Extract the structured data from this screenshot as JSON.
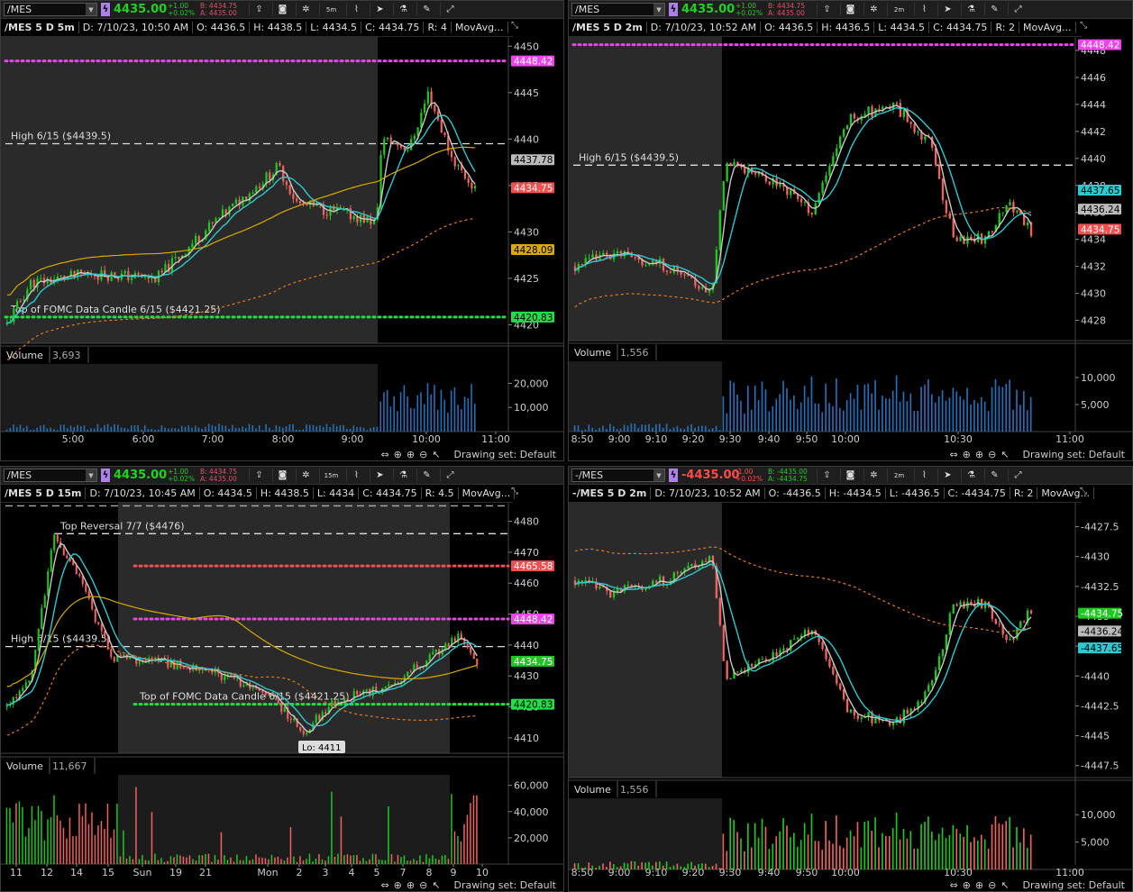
{
  "colors": {
    "up": "#1ec81e",
    "down": "#f0625f",
    "ma200": "#d8a900",
    "ema_cyan": "#2ec8d0",
    "ma_gray": "#c8c8c8",
    "vwap": "#e07a20",
    "magenta": "#ee44ee",
    "green_lvl": "#22dd44",
    "red_lvl": "#f05050",
    "vol_blue": "#2570b8"
  },
  "panels": [
    {
      "symbol": "/MES",
      "last": "4435.00",
      "neg": false,
      "change": "+1.00",
      "change_pct": "+0.02%",
      "bid": "B: 4434.75",
      "ask": "A: 4435.00",
      "timeframe": "5m",
      "info": [
        "/MES 5 D 5m",
        "D: 7/10/23, 10:50 AM",
        "O: 4436.5",
        "H: 4438.5",
        "L: 4434.5",
        "C: 4434.75",
        "R: 4",
        "MovAvg..."
      ],
      "volume_label": "Volume",
      "volume_value": "3,693",
      "price_ticks": [
        "4450",
        "4445",
        "4440",
        "4435",
        "4430",
        "4425",
        "4420"
      ],
      "vol_ticks": [
        "20,000",
        "10,000"
      ],
      "time_ticks": [
        "5:00",
        "6:00",
        "7:00",
        "8:00",
        "9:00",
        "10:00",
        "11:00"
      ],
      "annotations": [
        "High 6/15 ($4439.5)",
        "Top of FOMC Data Candle 6/15 ($4421.25)"
      ],
      "tags": [
        "4448.42",
        "4437.78",
        "4434.75",
        "4428.09",
        "4420.83"
      ],
      "drawing_set": "Drawing set: Default"
    },
    {
      "symbol": "/MES",
      "last": "4435.00",
      "neg": false,
      "change": "+1.00",
      "change_pct": "+0.02%",
      "bid": "B: 4434.75",
      "ask": "A: 4435.00",
      "timeframe": "2m",
      "info": [
        "/MES 5 D 2m",
        "D: 7/10/23, 10:52 AM",
        "O: 4436.5",
        "H: 4436.5",
        "L: 4434.5",
        "C: 4434.75",
        "R: 2",
        "MovAvg..."
      ],
      "volume_label": "Volume",
      "volume_value": "1,556",
      "price_ticks": [
        "4448",
        "4446",
        "4444",
        "4442",
        "4440",
        "4438",
        "4436",
        "4434",
        "4432",
        "4430",
        "4428"
      ],
      "vol_ticks": [
        "10,000",
        "5,000"
      ],
      "time_ticks": [
        "8:50",
        "9:00",
        "9:10",
        "9:20",
        "9:30",
        "9:40",
        "9:50",
        "10:00",
        "10:30",
        "11:00"
      ],
      "annotations": [
        "High 6/15 ($4439.5)"
      ],
      "tags": [
        "4448.42",
        "4437.65",
        "4436.24",
        "4434.75"
      ],
      "drawing_set": "Drawing set: Default"
    },
    {
      "symbol": "/MES",
      "last": "4435.00",
      "neg": false,
      "change": "+1.00",
      "change_pct": "+0.02%",
      "bid": "B: 4434.75",
      "ask": "A: 4435.00",
      "timeframe": "15m",
      "info": [
        "/MES 5 D 15m",
        "D: 7/10/23, 10:45 AM",
        "O: 4434.5",
        "H: 4438.5",
        "L: 4434",
        "C: 4434.75",
        "R: 4.5",
        "MovAvg..."
      ],
      "volume_label": "Volume",
      "volume_value": "11,667",
      "price_ticks": [
        "4480",
        "4470",
        "4460",
        "4450",
        "4440",
        "4430",
        "4420",
        "4410"
      ],
      "vol_ticks": [
        "60,000",
        "40,000",
        "20,000"
      ],
      "time_ticks": [
        "11",
        "12",
        "14",
        "15",
        "Sun",
        "19",
        "21",
        "Mon",
        "2",
        "3",
        "4",
        "5",
        "7",
        "8",
        "9",
        "10"
      ],
      "annotations": [
        "Top Reversal 7/7 ($4476)",
        "High 6/15 ($4439.5)",
        "Top of FOMC Data Candle 6/15 ($4421.25)",
        "Lo: 4411"
      ],
      "tags": [
        "4465.58",
        "4448.42",
        "4434.75",
        "4420.83"
      ],
      "drawing_set": "Drawing set: Default"
    },
    {
      "symbol": "-/MES",
      "last": "-4435.00",
      "neg": true,
      "change": "-1.00",
      "change_pct": "+0.02%",
      "bid": "B: -4435.00",
      "ask": "A: -4434.75",
      "timeframe": "2m",
      "info": [
        "-/MES 5 D 2m",
        "D: 7/10/23, 10:52 AM",
        "O: -4436.5",
        "H: -4434.5",
        "L: -4436.5",
        "C: -4434.75",
        "R: 2",
        "MovAvg..."
      ],
      "volume_label": "Volume",
      "volume_value": "1,556",
      "price_ticks": [
        "-4427.5",
        "-4430",
        "-4432.5",
        "-4435",
        "-4437.5",
        "-4440",
        "-4442.5",
        "-4445",
        "-4447.5"
      ],
      "vol_ticks": [
        "10,000",
        "5,000"
      ],
      "time_ticks": [
        "8:50",
        "9:00",
        "9:10",
        "9:20",
        "9:30",
        "9:40",
        "9:50",
        "10:00",
        "10:30",
        "11:00"
      ],
      "annotations": [],
      "tags": [
        "-4434.75",
        "-4436.24",
        "-4437.65"
      ],
      "drawing_set": "Drawing set: Default"
    }
  ]
}
